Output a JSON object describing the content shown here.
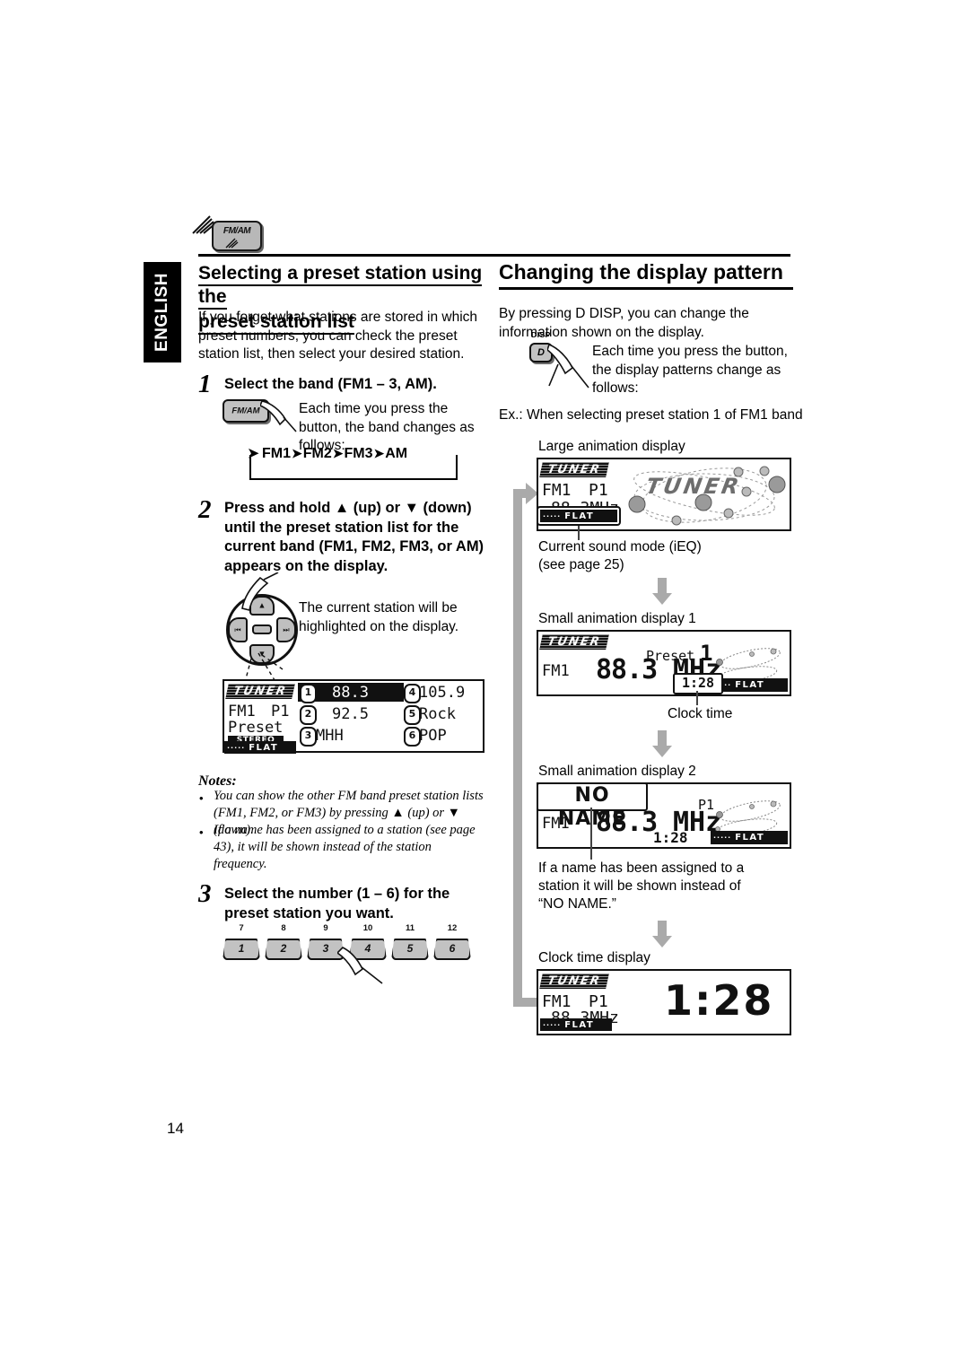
{
  "document": {
    "language_tab": "ENGLISH",
    "page_number": "14"
  },
  "top_icon": {
    "key_label": "FM/AM",
    "icon_name": "fm-am-button-icon"
  },
  "left_column": {
    "heading_line1": "Selecting a preset station using the",
    "heading_line2": "preset station list",
    "intro": "If you forget what stations are stored in which preset numbers, you can check the preset station list, then select your desired station.",
    "steps": [
      {
        "number": "1",
        "text": "Select the band (FM1 – 3, AM).",
        "key_label": "FM/AM",
        "note": "Each time you press the button, the band changes as follows:",
        "flow": [
          "FM1",
          "FM2",
          "FM3",
          "AM"
        ]
      },
      {
        "number": "2",
        "text": "Press and hold ▲ (up) or ▼ (down) until the preset station list for the current band (FM1, FM2, FM3, or AM) appears on the display.",
        "note": "The current station will be highlighted on the display."
      },
      {
        "number": "3",
        "text": "Select the number (1 – 6) for the preset station you want."
      }
    ],
    "preset_list_display": {
      "logo": "TUNER",
      "band": "FM1",
      "preset": "P1",
      "mode": "Preset",
      "stereo": "STEREO",
      "sound_mode": "FLAT",
      "sound_mode_dots": "·····",
      "entries": [
        {
          "num": "1",
          "value": "88.3",
          "highlighted": true
        },
        {
          "num": "2",
          "value": "92.5",
          "highlighted": false
        },
        {
          "num": "3",
          "value": "MHH",
          "highlighted": false
        },
        {
          "num": "4",
          "value": "105.9",
          "highlighted": false
        },
        {
          "num": "5",
          "value": "Rock",
          "highlighted": false
        },
        {
          "num": "6",
          "value": "POP",
          "highlighted": false
        }
      ]
    },
    "notes_title": "Notes:",
    "notes": [
      "You can show the other FM band preset station lists (FM1, FM2, or FM3) by pressing ▲ (up) or ▼ (down).",
      "If a name has been assigned to a station (see page 43), it will be shown instead of the station frequency."
    ],
    "preset_keys": [
      {
        "num": "1",
        "alt": "7"
      },
      {
        "num": "2",
        "alt": "8"
      },
      {
        "num": "3",
        "alt": "9"
      },
      {
        "num": "4",
        "alt": "10"
      },
      {
        "num": "5",
        "alt": "11"
      },
      {
        "num": "6",
        "alt": "12"
      }
    ]
  },
  "right_column": {
    "heading": "Changing the display pattern",
    "intro": "By pressing D DISP, you can change the information shown on the display.",
    "disp_key": {
      "label_above": "DISP",
      "cap_text": "D"
    },
    "disp_note": "Each time you press the button, the display patterns change as follows:",
    "example_line": "Ex.: When selecting preset station 1 of FM1 band",
    "patterns": [
      {
        "caption": "Large animation display",
        "display": {
          "logo": "TUNER",
          "band": "FM1",
          "preset": "P1",
          "frequency": "88.3MHz",
          "sound_mode": "FLAT",
          "sound_mode_dots": "·····",
          "animation_word": "TUNER"
        },
        "callout": "Current sound mode (iEQ)\n(see page 25)",
        "callout_line1": "Current sound mode (iEQ)",
        "callout_line2": "(see page 25)"
      },
      {
        "caption": "Small animation display 1",
        "display": {
          "logo": "TUNER",
          "band": "FM1",
          "preset_label": "Preset",
          "preset_number": "1",
          "frequency": "88.3",
          "unit": "MHz",
          "clock": "1:28",
          "sound_mode": "FLAT",
          "sound_mode_dots": "·····"
        },
        "callout_line1": "Clock time"
      },
      {
        "caption": "Small animation display 2",
        "display": {
          "name": "NO NAME",
          "band": "FM1",
          "preset": "P1",
          "frequency": "88.3",
          "unit": "MHz",
          "clock": "1:28",
          "sound_mode": "FLAT",
          "sound_mode_dots": "·····"
        },
        "callout_line1": "If a name has been assigned to a",
        "callout_line2": "station it will be shown instead of",
        "callout_line3": "“NO NAME.”"
      },
      {
        "caption": "Clock time display",
        "display": {
          "logo": "TUNER",
          "band": "FM1",
          "preset": "P1",
          "frequency": "88.3MHz",
          "clock": "1:28",
          "sound_mode": "FLAT",
          "sound_mode_dots": "·····"
        }
      }
    ]
  }
}
